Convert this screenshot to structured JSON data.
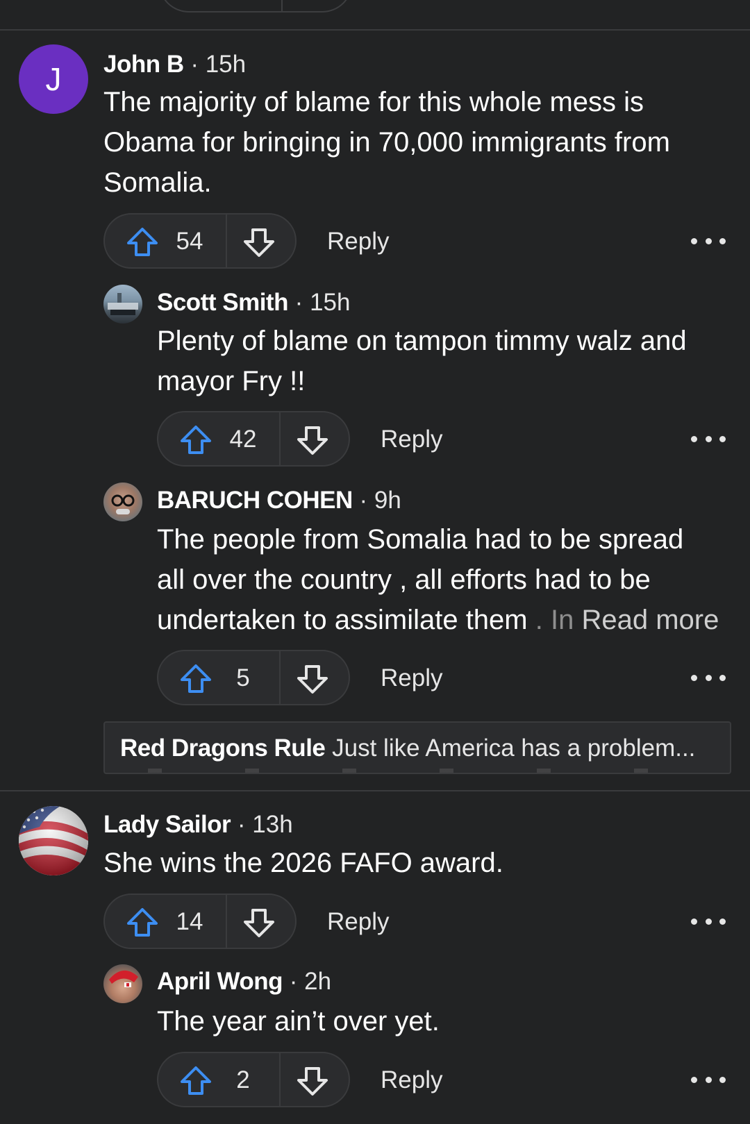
{
  "comments": [
    {
      "author": "John B",
      "time": "15h",
      "avatar_letter": "J",
      "body_lines": [
        "The majority of blame for this whole mess is",
        "Obama for bringing in 70,000 immigrants from",
        "Somalia."
      ],
      "upvotes": "54",
      "reply_label": "Reply",
      "replies": [
        {
          "author": "Scott Smith",
          "time": "15h",
          "body_lines": [
            "Plenty of blame on tampon timmy walz and",
            "mayor Fry !!"
          ],
          "upvotes": "42",
          "reply_label": "Reply"
        },
        {
          "author": "BARUCH COHEN",
          "time": "9h",
          "body_lines": [
            "The people from Somalia had to be spread",
            "all over the country , all efforts had to be",
            "undertaken to assimilate them"
          ],
          "body_fade": " . In",
          "read_more": "Read more",
          "upvotes": "5",
          "reply_label": "Reply"
        }
      ],
      "more_replies_preview": {
        "author": "Red Dragons Rule",
        "text": "Just like America has a problem..."
      }
    },
    {
      "author": "Lady Sailor",
      "time": "13h",
      "body_lines": [
        "She wins the 2026 FAFO award."
      ],
      "upvotes": "14",
      "reply_label": "Reply",
      "replies": [
        {
          "author": "April Wong",
          "time": "2h",
          "body_lines": [
            "The year ain’t over yet."
          ],
          "upvotes": "2",
          "reply_label": "Reply"
        }
      ]
    }
  ],
  "colors": {
    "background": "#222324",
    "upvote_blue": "#3d8ef2",
    "avatar_purple": "#6a2fc1"
  },
  "icons": {
    "upvote": "upvote-arrow-icon",
    "downvote": "downvote-arrow-icon",
    "more": "more-options-icon"
  }
}
